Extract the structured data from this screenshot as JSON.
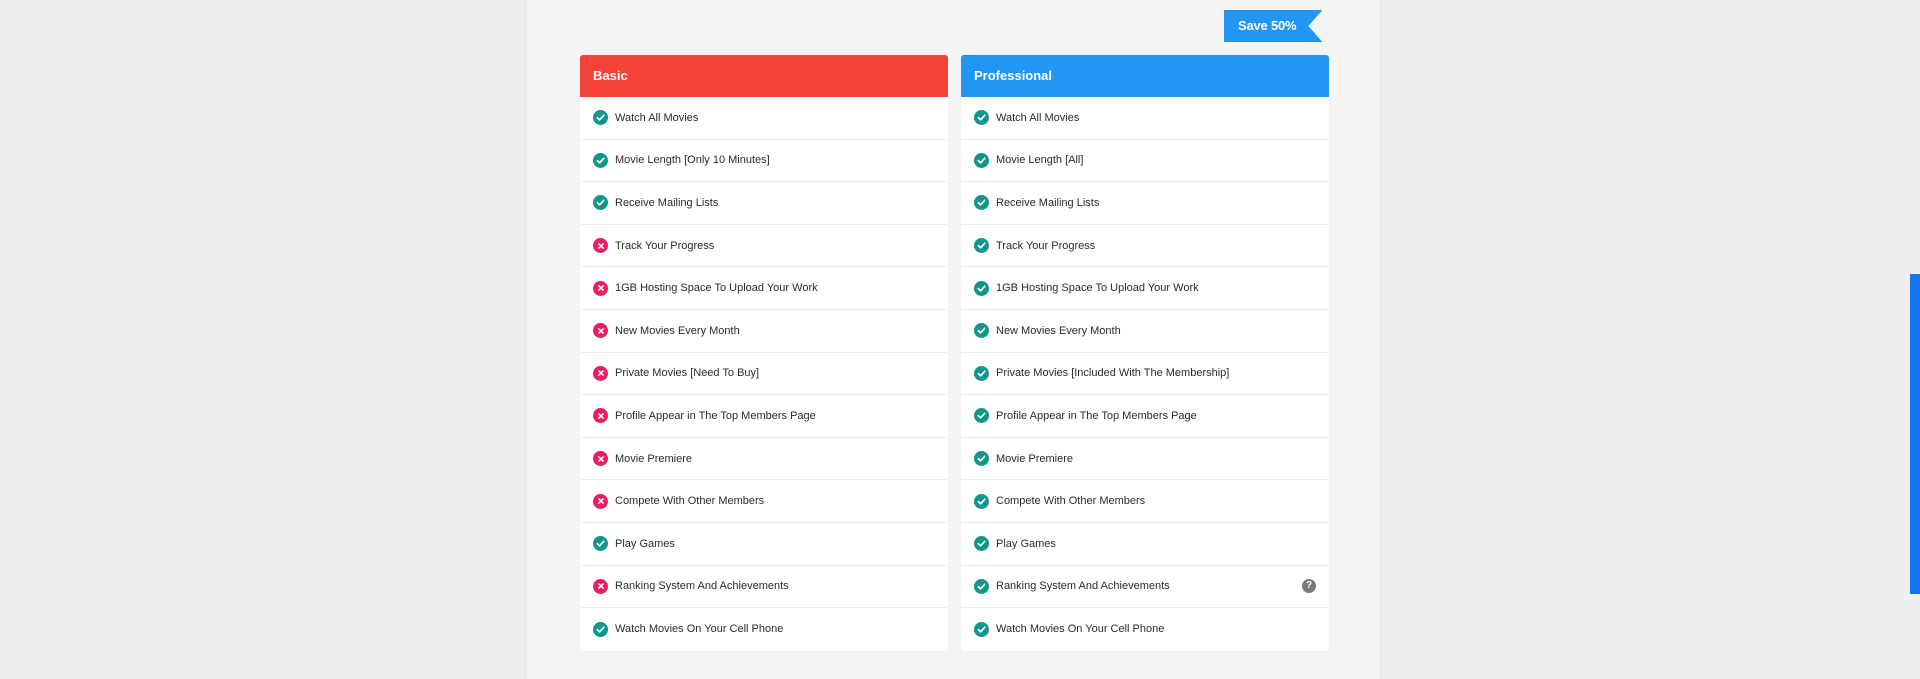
{
  "badge": {
    "text": "Save 50%"
  },
  "plans": [
    {
      "name": "Basic",
      "color": "#f44336",
      "features": [
        {
          "label": "Watch All Movies",
          "included": true
        },
        {
          "label": "Movie Length [Only 10 Minutes]",
          "included": true
        },
        {
          "label": "Receive Mailing Lists",
          "included": true
        },
        {
          "label": "Track Your Progress",
          "included": false
        },
        {
          "label": "1GB Hosting Space To Upload Your Work",
          "included": false
        },
        {
          "label": "New Movies Every Month",
          "included": false
        },
        {
          "label": "Private Movies [Need To Buy]",
          "included": false
        },
        {
          "label": "Profile Appear in The Top Members Page",
          "included": false
        },
        {
          "label": "Movie Premiere",
          "included": false
        },
        {
          "label": "Compete With Other Members",
          "included": false
        },
        {
          "label": "Play Games",
          "included": true
        },
        {
          "label": "Ranking System And Achievements",
          "included": false
        },
        {
          "label": "Watch Movies On Your Cell Phone",
          "included": true
        }
      ]
    },
    {
      "name": "Professional",
      "color": "#2196f3",
      "features": [
        {
          "label": "Watch All Movies",
          "included": true
        },
        {
          "label": "Movie Length [All]",
          "included": true
        },
        {
          "label": "Receive Mailing Lists",
          "included": true
        },
        {
          "label": "Track Your Progress",
          "included": true
        },
        {
          "label": "1GB Hosting Space To Upload Your Work",
          "included": true
        },
        {
          "label": "New Movies Every Month",
          "included": true
        },
        {
          "label": "Private Movies [Included With The Membership]",
          "included": true
        },
        {
          "label": "Profile Appear in The Top Members Page",
          "included": true
        },
        {
          "label": "Movie Premiere",
          "included": true
        },
        {
          "label": "Compete With Other Members",
          "included": true
        },
        {
          "label": "Play Games",
          "included": true
        },
        {
          "label": "Ranking System And Achievements",
          "included": true,
          "help": "?"
        },
        {
          "label": "Watch Movies On Your Cell Phone",
          "included": true
        }
      ]
    }
  ],
  "colors": {
    "check": "#12968a",
    "cross": "#e91e63",
    "scrollbar": "#1976f2"
  },
  "icons": {
    "included": "check-circle-icon",
    "excluded": "x-circle-icon",
    "help": "question-circle-icon"
  }
}
